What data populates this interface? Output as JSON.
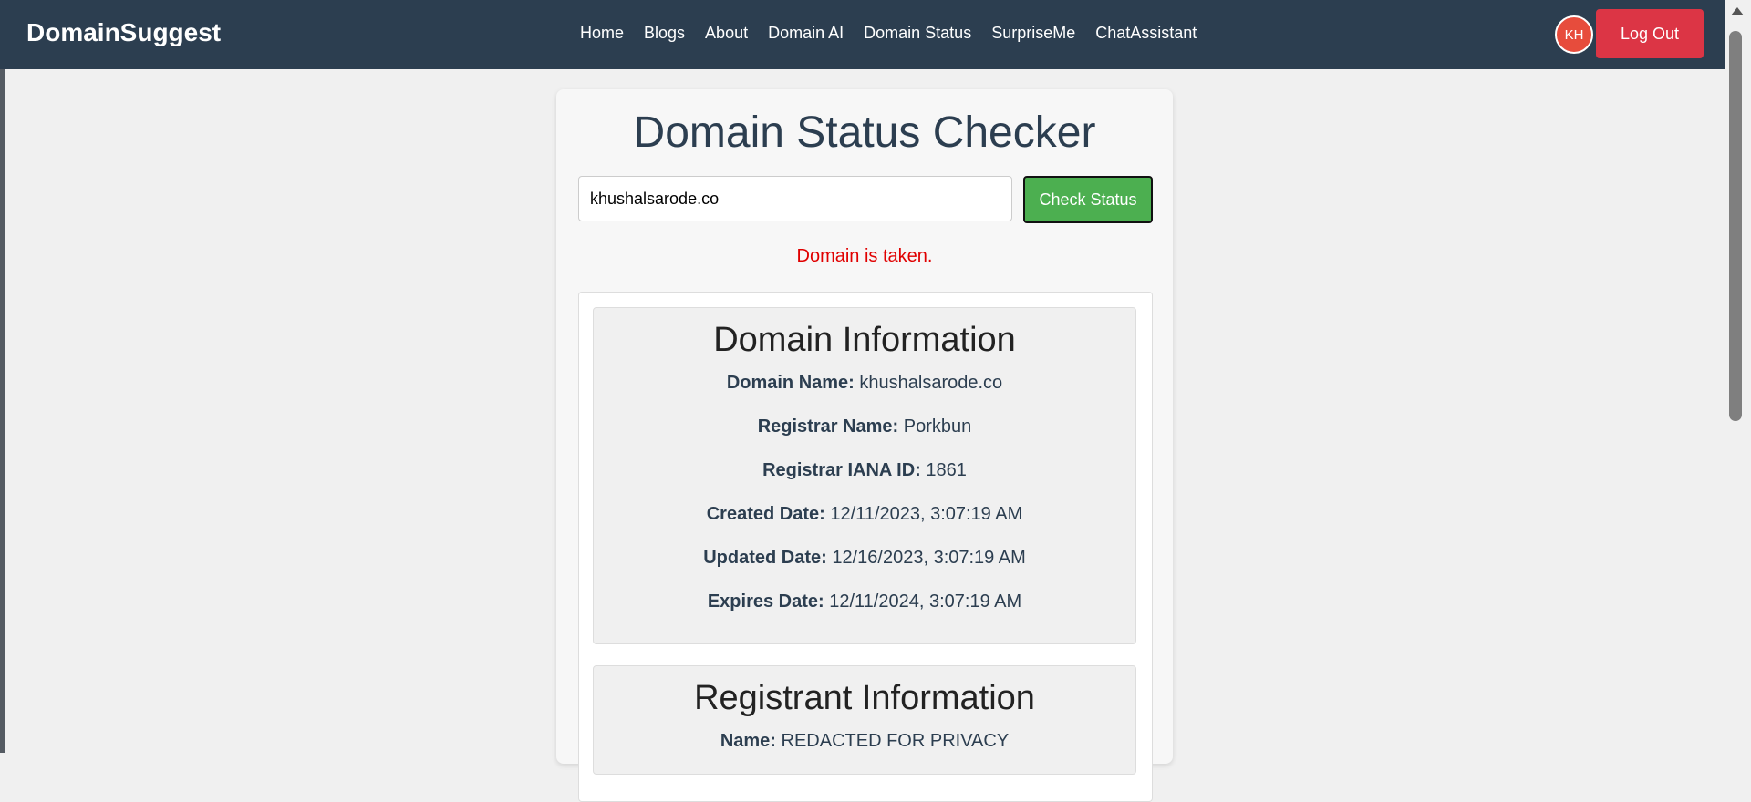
{
  "navbar": {
    "brand": "DomainSuggest",
    "links": [
      "Home",
      "Blogs",
      "About",
      "Domain AI",
      "Domain Status",
      "SurpriseMe",
      "ChatAssistant"
    ],
    "avatar_initials": "KH",
    "logout_label": "Log Out"
  },
  "checker": {
    "title": "Domain Status Checker",
    "input_value": "khushalsarode.co",
    "button_label": "Check Status",
    "status_message": "Domain is taken."
  },
  "domain_info": {
    "title": "Domain Information",
    "rows": [
      {
        "label": "Domain Name:",
        "value": "khushalsarode.co"
      },
      {
        "label": "Registrar Name:",
        "value": "Porkbun"
      },
      {
        "label": "Registrar IANA ID:",
        "value": "1861"
      },
      {
        "label": "Created Date:",
        "value": "12/11/2023, 3:07:19 AM"
      },
      {
        "label": "Updated Date:",
        "value": "12/16/2023, 3:07:19 AM"
      },
      {
        "label": "Expires Date:",
        "value": "12/11/2024, 3:07:19 AM"
      }
    ]
  },
  "registrant_info": {
    "title": "Registrant Information",
    "rows": [
      {
        "label": "Name:",
        "value": "REDACTED FOR PRIVACY"
      }
    ]
  },
  "colors": {
    "navbar": "#2c3e50",
    "logout": "#dc3545",
    "check_button": "#4caf50",
    "status_text": "#e00000",
    "avatar": "#e74c3c"
  }
}
